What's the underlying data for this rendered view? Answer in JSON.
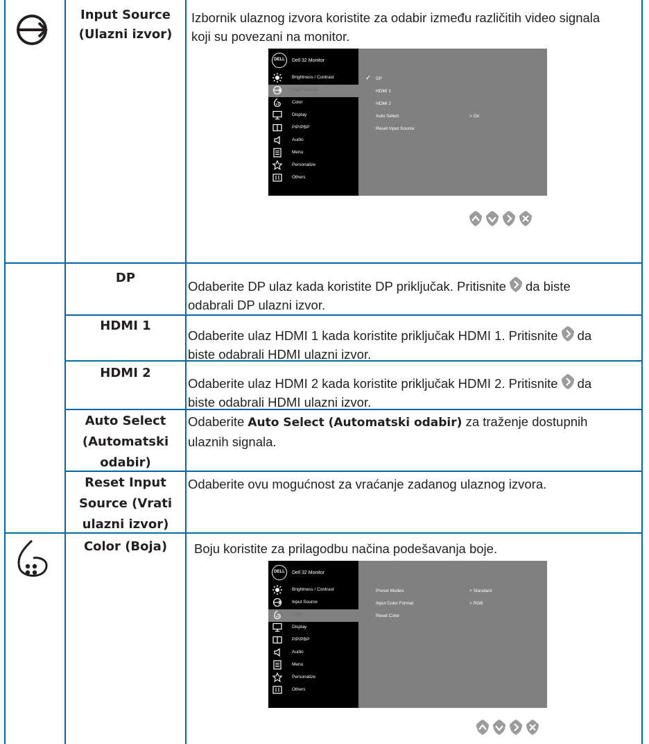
{
  "colors": {
    "border": "#0067a6",
    "osd_dark": "#000000",
    "osd_grey": "#808080"
  },
  "rows": {
    "input_source": {
      "icon": "input-source-icon",
      "name": "Input Source (Ulazni izvor)",
      "name_line1": "Input Source",
      "name_line2": "(Ulazni izvor)",
      "desc_line1": "Izbornik ulaznog izvora koristite za odabir između različitih video signala",
      "desc_line2": "koji su povezani na monitor."
    },
    "dp": {
      "name": "DP",
      "desc_a": "Odaberite DP ulaz kada koristite DP priključak. Pritisnite",
      "desc_b": "da biste",
      "desc_c": "odabrali DP ulazni izvor."
    },
    "hdmi1": {
      "name": "HDMI 1",
      "desc_a": "Odaberite ulaz HDMI 1 kada koristite priključak HDMI 1. Pritisnite",
      "desc_b": "da",
      "desc_c": "biste odabrali HDMI ulazni izvor."
    },
    "hdmi2": {
      "name": "HDMI 2",
      "desc_a": "Odaberite ulaz HDMI 2 kada koristite priključak HDMI 2. Pritisnite",
      "desc_b": "da",
      "desc_c": "biste odabrali HDMI ulazni izvor."
    },
    "auto_select": {
      "name_line1": "Auto Select",
      "name_line2": "(Automatski",
      "name_line3": "odabir)",
      "desc_a": "Odaberite",
      "desc_bold": "Auto Select (Automatski odabir)",
      "desc_b": "za traženje dostupnih",
      "desc_c": "ulaznih signala."
    },
    "reset_input": {
      "name_line1": "Reset Input",
      "name_line2": "Source (Vrati",
      "name_line3": "ulazni izvor)",
      "desc": "Odaberite ovu mogućnost za vraćanje zadanog ulaznog izvora."
    },
    "color": {
      "icon": "color-palette-icon",
      "name": "Color (Boja)",
      "desc": "Boju koristite za prilagodbu načina podešavanja boje."
    }
  },
  "osd": {
    "logo": "DELL",
    "title": "Dell 32 Monitor",
    "menu": [
      {
        "icon": "brightness-icon",
        "label": "Brightness / Contrast"
      },
      {
        "icon": "input-source-icon",
        "label": "Input Source"
      },
      {
        "icon": "color-icon",
        "label": "Color"
      },
      {
        "icon": "display-icon",
        "label": "Display"
      },
      {
        "icon": "pip-pbp-icon",
        "label": "PIP/PBP"
      },
      {
        "icon": "audio-icon",
        "label": "Audio"
      },
      {
        "icon": "menu-icon",
        "label": "Menu"
      },
      {
        "icon": "star-icon",
        "label": "Personalize"
      },
      {
        "icon": "others-icon",
        "label": "Others"
      }
    ],
    "input_submenu": {
      "check": "✓",
      "items": [
        "DP",
        "HDMI 1",
        "HDMI 2",
        "Auto Select",
        "Reset Input Source"
      ],
      "auto_select_value": "> On"
    },
    "color_submenu": {
      "items": [
        "Preset Modes",
        "Input Color Format",
        "Reset Color"
      ],
      "values": [
        "> Standard",
        "> RGB"
      ]
    }
  },
  "nav_buttons": [
    "up-button-icon",
    "down-button-icon",
    "right-button-icon",
    "close-button-icon"
  ]
}
